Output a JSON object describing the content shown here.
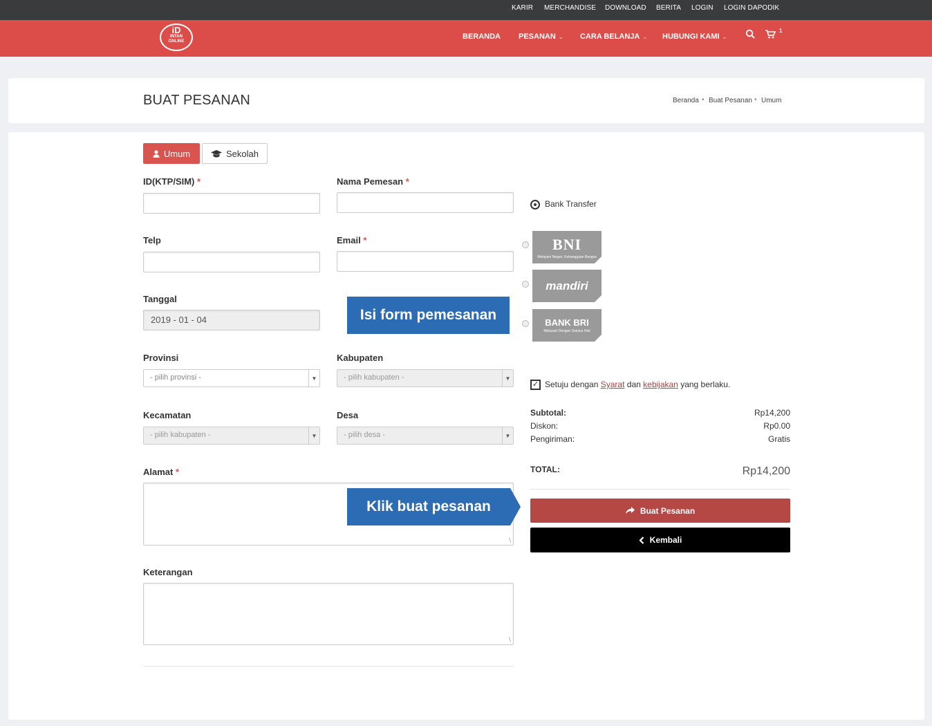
{
  "topbar": {
    "links": [
      "KARIR",
      "MERCHANDISE",
      "DOWNLOAD",
      "BERITA",
      "LOGIN",
      "LOGIN DAPODIK"
    ]
  },
  "navbar": {
    "logo": {
      "line1": "iD",
      "line2": "INTAN",
      "line3": "ONLINE"
    },
    "items": [
      "BERANDA",
      "PESANAN",
      "CARA BELANJA",
      "HUBUNGI KAMI"
    ],
    "cart_count": "1"
  },
  "header": {
    "title": "BUAT PESANAN",
    "breadcrumb": [
      "Beranda",
      "Buat Pesanan",
      "Umum"
    ],
    "breadcrumb_sep": "•"
  },
  "tabs": {
    "umum": "Umum",
    "sekolah": "Sekolah"
  },
  "form": {
    "id_label": "ID(KTP/SIM)",
    "nama_label": "Nama Pemesan",
    "telp_label": "Telp",
    "email_label": "Email",
    "tanggal_label": "Tanggal",
    "tanggal_value": "2019 - 01 - 04",
    "provinsi_label": "Provinsi",
    "provinsi_placeholder": "- pilih provinsi -",
    "kabupaten_label": "Kabupaten",
    "kabupaten_placeholder": "- pilih kabupaten -",
    "kecamatan_label": "Kecamatan",
    "kecamatan_placeholder": "- pilih kabupaten -",
    "desa_label": "Desa",
    "desa_placeholder": "- pilih desa -",
    "alamat_label": "Alamat",
    "keterangan_label": "Keterangan",
    "required_mark": "*"
  },
  "callouts": {
    "form": "Isi form pemesanan",
    "submit": "Klik buat pesanan"
  },
  "payment": {
    "method": "Bank Transfer",
    "banks": [
      {
        "name": "BNI",
        "tagline": "Melayani Negeri, Kebanggaan Bangsa"
      },
      {
        "name": "mandiri",
        "tagline": ""
      },
      {
        "name": "BANK BRI",
        "tagline": "Melayani Dengan Setulus Hati"
      }
    ]
  },
  "agree": {
    "prefix": "Setuju dengan",
    "link1": "Syarat",
    "middle": "dan",
    "link2": "kebijakan",
    "suffix": "yang berlaku."
  },
  "summary": {
    "subtotal_label": "Subtotal:",
    "subtotal_value": "Rp14,200",
    "diskon_label": "Diskon:",
    "diskon_value": "Rp0.00",
    "pengiriman_label": "Pengiriman:",
    "pengiriman_value": "Gratis",
    "total_label": "TOTAL:",
    "total_value": "Rp14,200"
  },
  "buttons": {
    "submit": "Buat Pesanan",
    "back": "Kembali"
  },
  "colors": {
    "brand": "#dc4d4a",
    "topbar": "#393b3d",
    "callout": "#2b6cb5",
    "submit": "#b54745",
    "back": "#000000"
  }
}
